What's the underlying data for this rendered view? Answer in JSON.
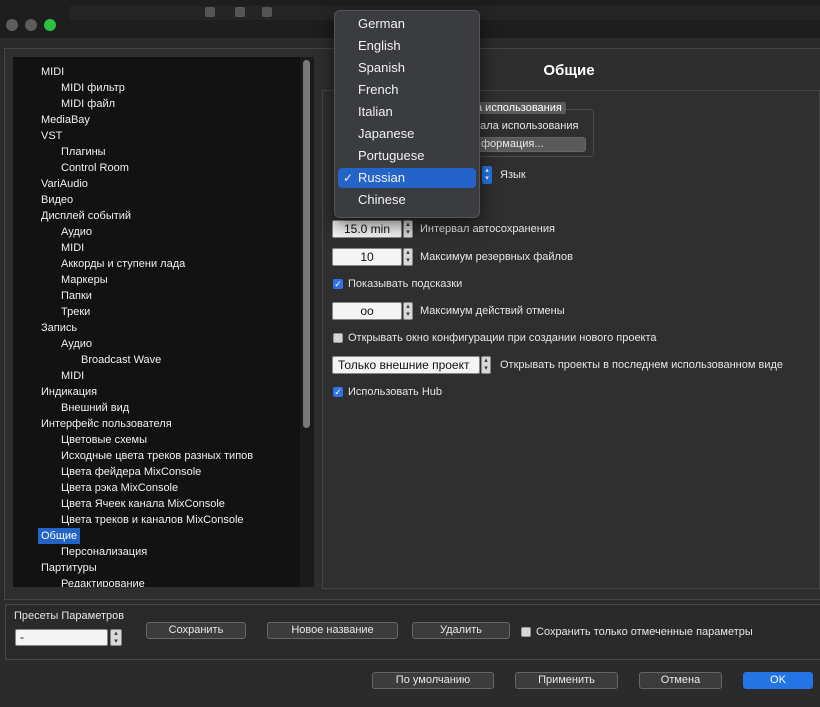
{
  "window": {
    "traffic_lights": {
      "close": "#5c5c5c",
      "minimize": "#5c5c5c",
      "zoom": "#29c241"
    }
  },
  "sidebar": {
    "items": [
      {
        "label": "MIDI",
        "level": 1
      },
      {
        "label": "MIDI фильтр",
        "level": 2
      },
      {
        "label": "MIDI файл",
        "level": 2
      },
      {
        "label": "MediaBay",
        "level": 1
      },
      {
        "label": "VST",
        "level": 1
      },
      {
        "label": "Плагины",
        "level": 2
      },
      {
        "label": "Control Room",
        "level": 2
      },
      {
        "label": "VariAudio",
        "level": 1
      },
      {
        "label": "Видео",
        "level": 1
      },
      {
        "label": "Дисплей событий",
        "level": 1
      },
      {
        "label": "Аудио",
        "level": 2
      },
      {
        "label": "MIDI",
        "level": 2
      },
      {
        "label": "Аккорды и ступени лада",
        "level": 2
      },
      {
        "label": "Маркеры",
        "level": 2
      },
      {
        "label": "Папки",
        "level": 2
      },
      {
        "label": "Треки",
        "level": 2
      },
      {
        "label": "Запись",
        "level": 1
      },
      {
        "label": "Аудио",
        "level": 2
      },
      {
        "label": "Broadcast Wave",
        "level": 3
      },
      {
        "label": "MIDI",
        "level": 2
      },
      {
        "label": "Индикация",
        "level": 1
      },
      {
        "label": "Внешний вид",
        "level": 2
      },
      {
        "label": "Интерфейс пользователя",
        "level": 1
      },
      {
        "label": "Цветовые схемы",
        "level": 2
      },
      {
        "label": "Исходные цвета треков разных типов",
        "level": 2
      },
      {
        "label": "Цвета фейдера MixConsole",
        "level": 2
      },
      {
        "label": "Цвета рэка MixConsole",
        "level": 2
      },
      {
        "label": "Цвета Ячеек канала MixConsole",
        "level": 2
      },
      {
        "label": "Цвета треков и каналов MixConsole",
        "level": 2
      },
      {
        "label": "Общие",
        "level": 1,
        "selected": true
      },
      {
        "label": "Персонализация",
        "level": 2
      },
      {
        "label": "Партитуры",
        "level": 1
      },
      {
        "label": "Редактирование",
        "level": 2
      }
    ]
  },
  "main": {
    "title": "Общие",
    "usage_group": {
      "label": "а использования",
      "line": "нала использования",
      "info_button": "формация..."
    },
    "language_label": "Язык",
    "autosave": {
      "value": "15.0 min",
      "label": "Интервал автосохранения"
    },
    "backups": {
      "value": "10",
      "label": "Максимум резервных файлов"
    },
    "show_tooltips": {
      "checked": true,
      "label": "Показывать подсказки"
    },
    "undo": {
      "value": "oo",
      "label": "Максимум действий отмены"
    },
    "open_config": {
      "checked": false,
      "label": "Открывать окно конфигурации при создании нового проекта"
    },
    "open_projects": {
      "value": "Только внешние проект",
      "label": "Открывать проекты в последнем использованном виде"
    },
    "use_hub": {
      "checked": true,
      "label": "Использовать Hub"
    }
  },
  "language_menu": {
    "options": [
      "German",
      "English",
      "Spanish",
      "French",
      "Italian",
      "Japanese",
      "Portuguese",
      "Russian",
      "Chinese"
    ],
    "selected": "Russian"
  },
  "presets": {
    "title": "Пресеты Параметров",
    "value": "-",
    "save": "Сохранить",
    "rename": "Новое название",
    "delete": "Удалить",
    "only_marked": {
      "checked": false,
      "label": "Сохранить только отмеченные параметры"
    }
  },
  "footer": {
    "defaults": "По умолчанию",
    "apply": "Применить",
    "cancel": "Отмена",
    "ok": "OK"
  },
  "colors": {
    "accent": "#2474e6",
    "selection": "#2463c8"
  }
}
